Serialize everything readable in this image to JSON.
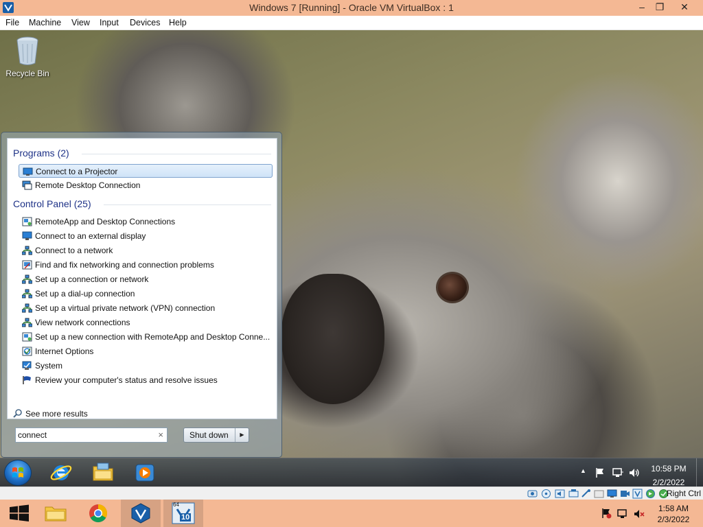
{
  "host_window": {
    "title": "Windows 7 [Running] - Oracle VM VirtualBox : 1",
    "minimize_glyph": "–",
    "restore_glyph": "❐",
    "close_glyph": "✕",
    "app_icon": "virtualbox-icon"
  },
  "menubar": {
    "items": [
      "File",
      "Machine",
      "View",
      "Input",
      "Devices",
      "Help"
    ]
  },
  "desktop": {
    "icons": [
      {
        "label": "Recycle Bin",
        "icon": "recycle-bin-icon"
      }
    ]
  },
  "start_menu": {
    "groups": [
      {
        "title": "Programs (2)",
        "items": [
          {
            "label": "Connect to a Projector",
            "icon": "projector-icon",
            "selected": true
          },
          {
            "label": "Remote Desktop Connection",
            "icon": "remote-desktop-icon"
          }
        ]
      },
      {
        "title": "Control Panel (25)",
        "items": [
          {
            "label": "RemoteApp and Desktop Connections",
            "icon": "remoteapp-icon"
          },
          {
            "label": "Connect to an external display",
            "icon": "display-icon"
          },
          {
            "label": "Connect to a network",
            "icon": "network-icon"
          },
          {
            "label": "Find and fix networking and connection problems",
            "icon": "troubleshoot-icon"
          },
          {
            "label": "Set up a connection or network",
            "icon": "network-icon"
          },
          {
            "label": "Set up a dial-up connection",
            "icon": "network-icon"
          },
          {
            "label": "Set up a virtual private network (VPN) connection",
            "icon": "network-icon"
          },
          {
            "label": "View network connections",
            "icon": "network-icon"
          },
          {
            "label": "Set up a new connection with RemoteApp and Desktop Conne...",
            "icon": "remoteapp-icon"
          },
          {
            "label": "Internet Options",
            "icon": "internet-options-icon"
          },
          {
            "label": "System",
            "icon": "system-icon"
          },
          {
            "label": "Review your computer's status and resolve issues",
            "icon": "action-center-flag-icon"
          }
        ]
      }
    ],
    "see_more": "See more results",
    "search": {
      "value": "connect",
      "clear_glyph": "×"
    },
    "shutdown_label": "Shut down",
    "shutdown_arrow": "▶"
  },
  "guest_taskbar": {
    "pinned": [
      "internet-explorer-icon",
      "windows-explorer-icon",
      "media-player-icon"
    ],
    "tray_icons": [
      "show-hidden-icons-arrow",
      "action-center-flag-icon",
      "network-icon",
      "volume-icon"
    ],
    "tray_arrow": "▲",
    "time": "10:58 PM",
    "date": "2/2/2022"
  },
  "vbox_status": {
    "icons": [
      "hard-disk-icon",
      "optical-drive-icon",
      "audio-icon",
      "network-adapter-icon",
      "usb-icon",
      "shared-folders-icon",
      "display-icon",
      "video-capture-icon",
      "virtualization-icon",
      "mouse-integration-icon",
      "keyboard-icon"
    ],
    "host_key": "Right Ctrl"
  },
  "host_taskbar": {
    "apps": [
      "start-windows-icon",
      "file-explorer-icon",
      "chrome-icon",
      "virtualbox-icon",
      "virtualbox-vm-icon"
    ],
    "vm_badge_top": "64",
    "vm_badge_bottom": "10",
    "tray_icons": [
      "flag-icon",
      "network-icon",
      "volume-muted-icon"
    ],
    "time": "1:58 AM",
    "date": "2/3/2022"
  }
}
